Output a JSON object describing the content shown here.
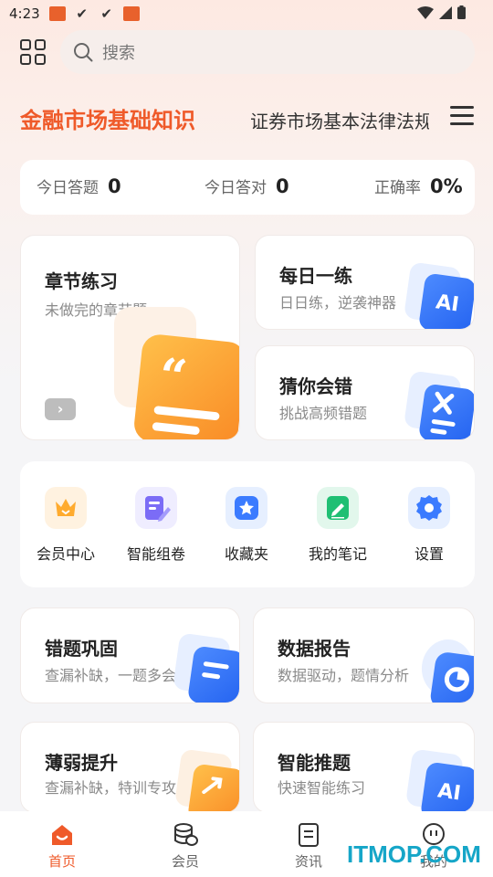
{
  "status_bar": {
    "time": "4:23"
  },
  "search": {
    "placeholder": "搜索"
  },
  "subjects": {
    "active": "金融市场基础知识",
    "other": "证券市场基本法律法规"
  },
  "stats": [
    {
      "label": "今日答题",
      "value": "0"
    },
    {
      "label": "今日答对",
      "value": "0"
    },
    {
      "label": "正确率",
      "value": "0%"
    }
  ],
  "cards": {
    "chapter": {
      "title": "章节练习",
      "subtitle": "未做完的章节题"
    },
    "daily": {
      "title": "每日一练",
      "subtitle": "日日练，逆袭神器",
      "badge": "AI"
    },
    "guess": {
      "title": "猜你会错",
      "subtitle": "挑战高频错题"
    },
    "wrong": {
      "title": "错题巩固",
      "subtitle": "查漏补缺，一题多会"
    },
    "report": {
      "title": "数据报告",
      "subtitle": "数据驱动，题情分析"
    },
    "weak": {
      "title": "薄弱提升",
      "subtitle": "查漏补缺，特训专攻"
    },
    "smart": {
      "title": "智能推题",
      "subtitle": "快速智能练习",
      "badge": "AI"
    }
  },
  "quick_menu": [
    {
      "label": "会员中心",
      "icon": "crown-icon",
      "color": "#ffab2e",
      "bg": "#fff2e0"
    },
    {
      "label": "智能组卷",
      "icon": "paper-edit-icon",
      "color": "#7b6cf6",
      "bg": "#efedff"
    },
    {
      "label": "收藏夹",
      "icon": "star-icon",
      "color": "#3b7bff",
      "bg": "#e6efff"
    },
    {
      "label": "我的笔记",
      "icon": "note-icon",
      "color": "#1fbf73",
      "bg": "#e2f7ec"
    },
    {
      "label": "设置",
      "icon": "gear-icon",
      "color": "#3b7bff",
      "bg": "#e6efff"
    }
  ],
  "bottom_nav": [
    {
      "label": "首页",
      "icon": "home-icon",
      "active": true
    },
    {
      "label": "会员",
      "icon": "coins-icon",
      "active": false
    },
    {
      "label": "资讯",
      "icon": "news-icon",
      "active": false
    },
    {
      "label": "我的",
      "icon": "profile-icon",
      "active": false
    }
  ],
  "watermark": "ITMOP.COM",
  "colors": {
    "accent": "#ef5a2a",
    "blue": "#3b7bff"
  }
}
